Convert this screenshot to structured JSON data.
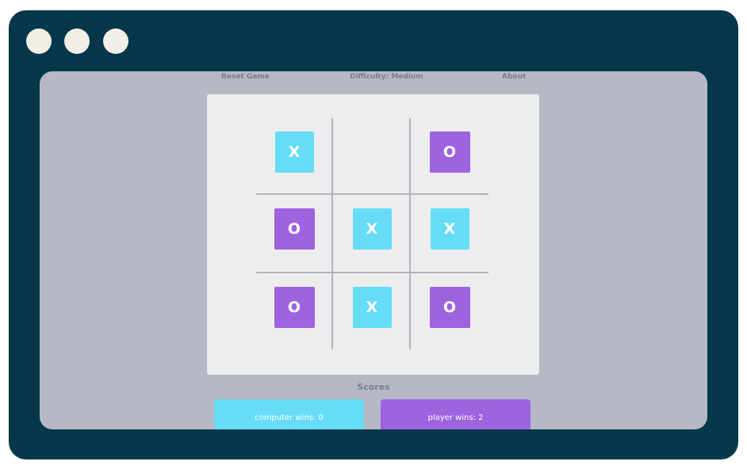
{
  "window": {
    "controls": [
      "window-dot",
      "window-dot",
      "window-dot"
    ]
  },
  "nav": {
    "reset": "Reset Game",
    "difficulty": "Difficulty: Medium",
    "about": "About"
  },
  "board": {
    "cells": [
      "X",
      "",
      "O",
      "O",
      "X",
      "X",
      "O",
      "X",
      "O"
    ]
  },
  "scores": {
    "title": "Scores",
    "computer": "computer wins: 0",
    "player": "player wins: 2"
  },
  "colors": {
    "frame": "#07374b",
    "viewport": "#b6b8c6",
    "board_bg": "#ededee",
    "x_tile": "#67dcf6",
    "o_tile": "#9e63de"
  }
}
